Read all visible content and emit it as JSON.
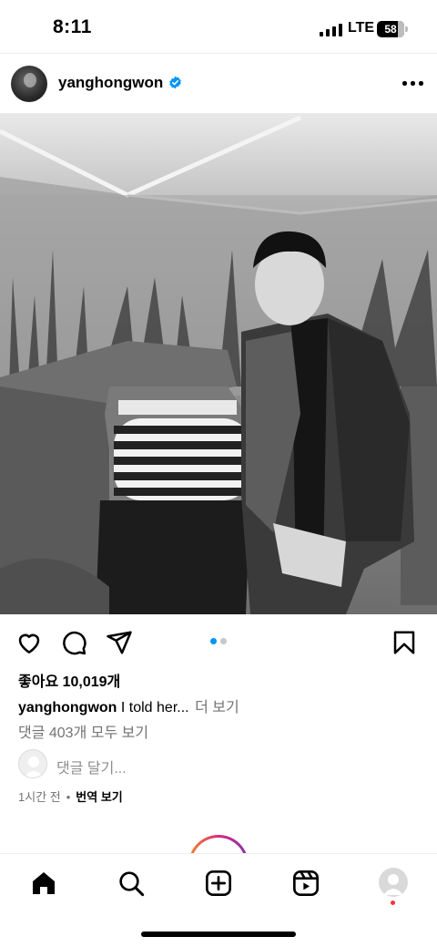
{
  "status_bar": {
    "time": "8:11",
    "network": "LTE",
    "battery": "58"
  },
  "post": {
    "username": "yanghongwon",
    "verified": true,
    "photo_icon": "photo",
    "carousel": {
      "total": 2,
      "active": 1,
      "active_color": "#0095f6",
      "inactive_color": "#c7c7c7"
    },
    "likes": "좋아요 10,019개",
    "caption_user": "yanghongwon",
    "caption_text": "I told her...",
    "caption_more": "더 보기",
    "view_comments": "댓글 403개 모두 보기",
    "add_comment_placeholder": "댓글 달기...",
    "time_ago": "1시간 전",
    "separator": "•",
    "translate": "번역 보기"
  },
  "colors": {
    "verified_blue": "#0095f6",
    "secondary_text": "#737373",
    "notification_red": "#ff3040"
  },
  "tabs": [
    {
      "name": "home",
      "icon": "home-icon"
    },
    {
      "name": "search",
      "icon": "search-icon"
    },
    {
      "name": "create",
      "icon": "plus-square-icon"
    },
    {
      "name": "reels",
      "icon": "reels-icon"
    },
    {
      "name": "profile",
      "icon": "profile-avatar"
    }
  ]
}
